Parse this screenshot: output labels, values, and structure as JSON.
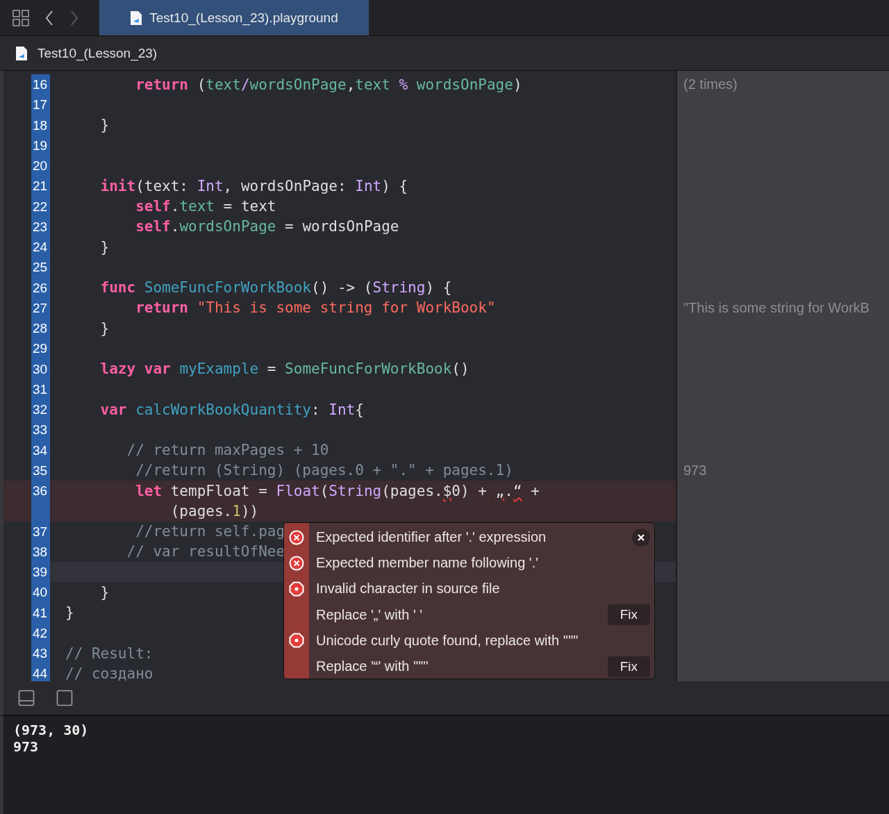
{
  "tabs": [
    {
      "label": "Test10_(Lesson_23).playground",
      "selected": true
    }
  ],
  "navigation": {
    "back_enabled": true,
    "forward_enabled": false
  },
  "breadcrumb": "Test10_(Lesson_23)",
  "lines": [
    {
      "number": "16",
      "tokens": [
        {
          "text": "        return",
          "kind": "kw"
        },
        {
          "text": " (",
          "kind": "plain"
        },
        {
          "text": "text",
          "kind": "prop"
        },
        {
          "text": "/",
          "kind": "type"
        },
        {
          "text": "wordsOnPage",
          "kind": "prop"
        },
        {
          "text": ",",
          "kind": "plain"
        },
        {
          "text": "text ",
          "kind": "prop"
        },
        {
          "text": "% ",
          "kind": "type"
        },
        {
          "text": "wordsOnPage",
          "kind": "prop"
        },
        {
          "text": ")",
          "kind": "plain"
        }
      ],
      "result": "(2 times)"
    },
    {
      "number": "17"
    },
    {
      "number": "18",
      "tokens": [
        {
          "text": "    }",
          "kind": "plain"
        }
      ]
    },
    {
      "number": "19"
    },
    {
      "number": "20"
    },
    {
      "number": "21",
      "tokens": [
        {
          "text": "    init",
          "kind": "kw"
        },
        {
          "text": "(text: ",
          "kind": "plain"
        },
        {
          "text": "Int",
          "kind": "type"
        },
        {
          "text": ", wordsOnPage: ",
          "kind": "plain"
        },
        {
          "text": "Int",
          "kind": "type"
        },
        {
          "text": ") {",
          "kind": "plain"
        }
      ]
    },
    {
      "number": "22",
      "tokens": [
        {
          "text": "        self",
          "kind": "kw"
        },
        {
          "text": ".",
          "kind": "plain"
        },
        {
          "text": "text",
          "kind": "prop"
        },
        {
          "text": " = text",
          "kind": "plain"
        }
      ]
    },
    {
      "number": "23",
      "tokens": [
        {
          "text": "        self",
          "kind": "kw"
        },
        {
          "text": ".",
          "kind": "plain"
        },
        {
          "text": "wordsOnPage",
          "kind": "prop"
        },
        {
          "text": " = wordsOnPage",
          "kind": "plain"
        }
      ]
    },
    {
      "number": "24",
      "tokens": [
        {
          "text": "    }",
          "kind": "plain"
        }
      ]
    },
    {
      "number": "25"
    },
    {
      "number": "26",
      "tokens": [
        {
          "text": "    func ",
          "kind": "kw"
        },
        {
          "text": "SomeFuncForWorkBook",
          "kind": "decl"
        },
        {
          "text": "() -> (",
          "kind": "plain"
        },
        {
          "text": "String",
          "kind": "type"
        },
        {
          "text": ") {",
          "kind": "plain"
        }
      ]
    },
    {
      "number": "27",
      "tokens": [
        {
          "text": "        return ",
          "kind": "kw"
        },
        {
          "text": "\"This is some string for WorkBook\"",
          "kind": "str"
        }
      ],
      "result": "\"This is some string for WorkB"
    },
    {
      "number": "28",
      "tokens": [
        {
          "text": "    }",
          "kind": "plain"
        }
      ]
    },
    {
      "number": "29"
    },
    {
      "number": "30",
      "tokens": [
        {
          "text": "    lazy var ",
          "kind": "kw"
        },
        {
          "text": "myExample",
          "kind": "decl"
        },
        {
          "text": " = ",
          "kind": "plain"
        },
        {
          "text": "SomeFuncForWorkBook",
          "kind": "call"
        },
        {
          "text": "()",
          "kind": "plain"
        }
      ]
    },
    {
      "number": "31"
    },
    {
      "number": "32",
      "tokens": [
        {
          "text": "    var ",
          "kind": "kw"
        },
        {
          "text": "calcWorkBookQuantity",
          "kind": "decl"
        },
        {
          "text": ": ",
          "kind": "plain"
        },
        {
          "text": "Int",
          "kind": "type"
        },
        {
          "text": "{",
          "kind": "plain"
        }
      ]
    },
    {
      "number": "33"
    },
    {
      "number": "34",
      "tokens": [
        {
          "text": "       // return maxPages + 10",
          "kind": "comment"
        }
      ]
    },
    {
      "number": "35",
      "tokens": [
        {
          "text": "        //return (String) (pages.0 + \".\" + pages.1)",
          "kind": "comment"
        }
      ],
      "result": "973"
    },
    {
      "number": "36",
      "error": true,
      "tokens": [
        {
          "text": "        let",
          "kind": "kw"
        },
        {
          "text": " tempFloat = ",
          "kind": "plain"
        },
        {
          "text": "Float",
          "kind": "type"
        },
        {
          "text": "(",
          "kind": "plain"
        },
        {
          "text": "String",
          "kind": "type"
        },
        {
          "text": "(pages.",
          "kind": "plain"
        },
        {
          "text": "$",
          "kind": "invalid"
        },
        {
          "text": "0) + ",
          "kind": "plain"
        },
        {
          "text": "„",
          "kind": "invalid"
        },
        {
          "text": ".",
          "kind": "plain"
        },
        {
          "text": "“",
          "kind": "invalid"
        },
        {
          "text": " +",
          "kind": "plain"
        }
      ],
      "wrap": [
        {
          "text": "            (pages.",
          "kind": "plain"
        },
        {
          "text": "1",
          "kind": "num"
        },
        {
          "text": "))",
          "kind": "plain"
        }
      ]
    },
    {
      "number": "37",
      "tokens": [
        {
          "text": "        //return self.pag",
          "kind": "comment"
        }
      ]
    },
    {
      "number": "38",
      "tokens": [
        {
          "text": "       // var resultOfNee",
          "kind": "comment"
        }
      ]
    },
    {
      "number": "39",
      "current": true
    },
    {
      "number": "40",
      "tokens": [
        {
          "text": "    }",
          "kind": "plain"
        }
      ]
    },
    {
      "number": "41",
      "tokens": [
        {
          "text": "}",
          "kind": "plain"
        }
      ]
    },
    {
      "number": "42"
    },
    {
      "number": "43",
      "tokens": [
        {
          "text": "// Result:",
          "kind": "comment"
        }
      ]
    },
    {
      "number": "44",
      "tokens": [
        {
          "text": "// создано",
          "kind": "comment"
        }
      ]
    }
  ],
  "issues": [
    {
      "kind": "error",
      "text": "Expected identifier after '.' expression"
    },
    {
      "kind": "error",
      "text": "Expected member name following '.'"
    },
    {
      "kind": "fixit",
      "text": "Invalid character in source file"
    },
    {
      "kind": "fix",
      "text": "Replace '„' with ' '",
      "button": "Fix"
    },
    {
      "kind": "fixit",
      "text": "Unicode curly quote found, replace with '\"\"'"
    },
    {
      "kind": "fix",
      "text": "Replace '“' with '\"\"'",
      "button": "Fix"
    }
  ],
  "console": [
    "(973, 30)",
    "973"
  ]
}
